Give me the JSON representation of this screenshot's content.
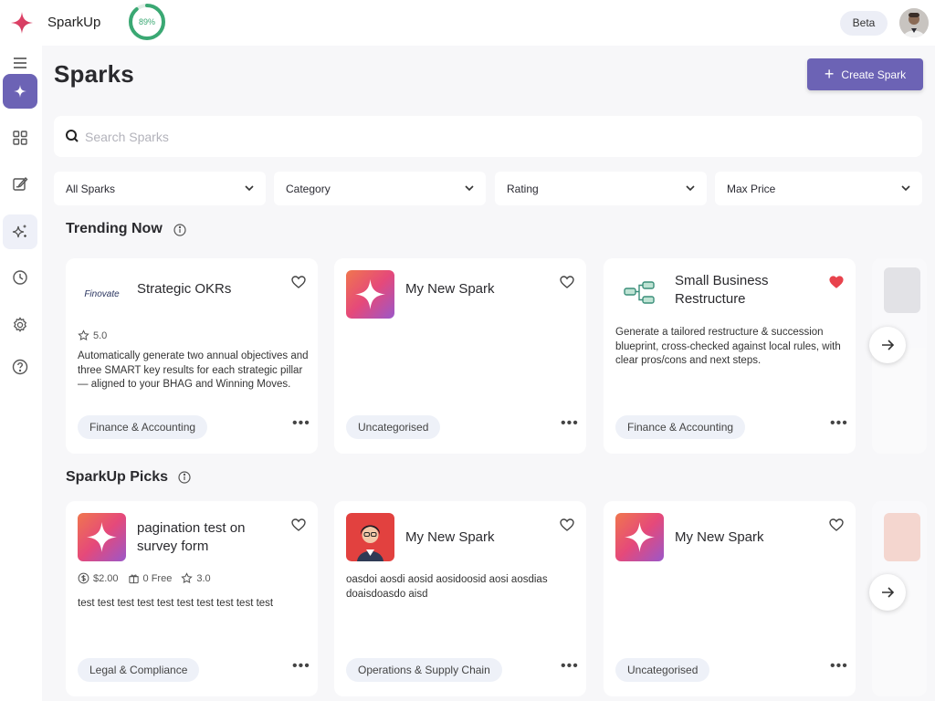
{
  "app": {
    "brand": "SparkUp",
    "progress_label": "89%",
    "progress_value": 0.89,
    "beta_label": "Beta",
    "accent_color": "#6c63b5",
    "progress_color": "#3aa873"
  },
  "sidebar": {
    "items": [
      {
        "icon": "menu-icon"
      },
      {
        "icon": "sparks-icon",
        "active": true
      },
      {
        "icon": "grid-icon"
      },
      {
        "icon": "edit-icon"
      },
      {
        "icon": "sparkles-icon"
      },
      {
        "icon": "history-icon"
      },
      {
        "icon": "gear-icon"
      },
      {
        "icon": "help-icon"
      }
    ]
  },
  "page": {
    "title": "Sparks",
    "create_label": "Create Spark",
    "search_placeholder": "Search Sparks"
  },
  "filters": [
    {
      "label": "All Sparks"
    },
    {
      "label": "Category"
    },
    {
      "label": "Rating"
    },
    {
      "label": "Max Price"
    }
  ],
  "sections": {
    "trending": {
      "title": "Trending Now",
      "cards": [
        {
          "logo_text": "Finovate",
          "title": "Strategic OKRs",
          "rating": "5.0",
          "description": "Automatically generate two annual objectives and three SMART key results for each strategic pillar — aligned to your BHAG and Winning Moves.",
          "tag": "Finance & Accounting",
          "favorite": false
        },
        {
          "title": "My New Spark",
          "description": "",
          "tag": "Uncategorised",
          "favorite": false
        },
        {
          "title": "Small Business Restructure",
          "description": "Generate a tailored restructure & succession blueprint, cross-checked against local rules, with clear pros/cons and next steps.",
          "tag": "Finance & Accounting",
          "favorite": true
        }
      ]
    },
    "picks": {
      "title": "SparkUp Picks",
      "cards": [
        {
          "title": "pagination test on survey form",
          "price": "$2.00",
          "free": "0 Free",
          "rating": "3.0",
          "description": "test test test test test test test test test test",
          "tag": "Legal & Compliance",
          "favorite": false
        },
        {
          "title": "My New Spark",
          "description": "oasdoi aosdi aosid aosidoosid aosi aosdias doaisdoasdo aisd",
          "tag": "Operations & Supply Chain",
          "favorite": false
        },
        {
          "title": "My New Spark",
          "description": "",
          "tag": "Uncategorised",
          "favorite": false
        }
      ]
    }
  }
}
